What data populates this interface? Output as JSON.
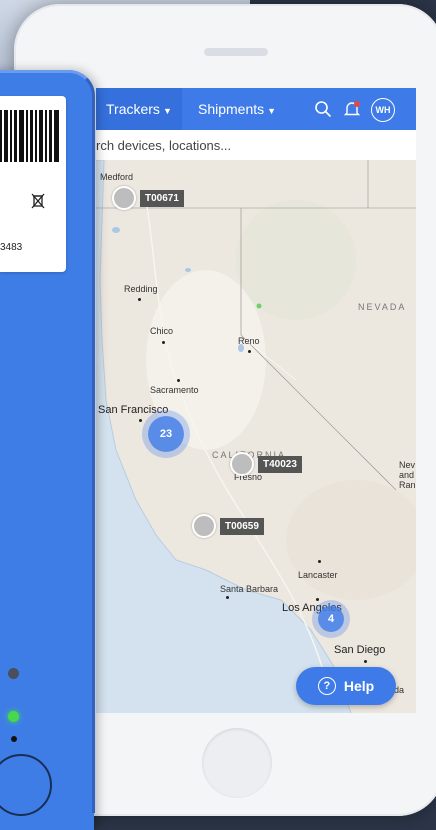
{
  "nav": {
    "trackers_label": "Trackers",
    "shipments_label": "Shipments",
    "avatar_initials": "WH"
  },
  "search": {
    "placeholder": "rch devices, locations..."
  },
  "map": {
    "state_labels": [
      "NEVADA",
      "CALIFORNIA"
    ],
    "cities": [
      "Medford",
      "Redding",
      "Chico",
      "Reno",
      "Sacramento",
      "San Francisco",
      "Fresno",
      "Lancaster",
      "Santa Barbara",
      "Los Angeles",
      "San Diego"
    ],
    "edge_text": [
      "Nev",
      "and",
      "Ran",
      "ada"
    ],
    "trackers": [
      "T00671",
      "T40023",
      "T00659"
    ],
    "clusters": [
      "23",
      "4"
    ]
  },
  "help": {
    "label": "Help"
  },
  "device": {
    "label_number": "3483"
  },
  "colors": {
    "brand_blue": "#3f7be8",
    "led_green": "#46d94c"
  }
}
